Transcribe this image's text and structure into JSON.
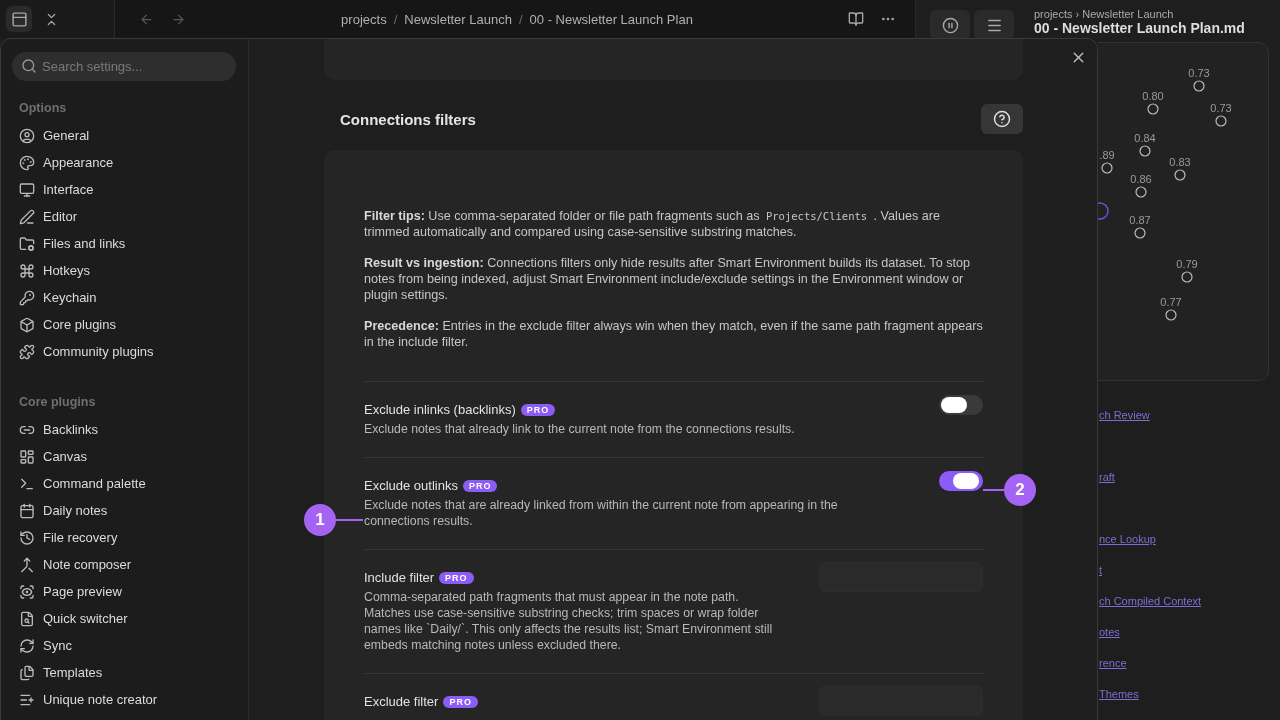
{
  "top_bar": {
    "breadcrumb": {
      "separator": "/",
      "parts": [
        "projects",
        "Newsletter Launch",
        "00 - Newsletter Launch Plan"
      ]
    }
  },
  "right_pane": {
    "path": "projects › Newsletter Launch",
    "title": "00 - Newsletter Launch Plan.md",
    "graph_nodes": [
      {
        "label": "0.73"
      },
      {
        "label": "0.80"
      },
      {
        "label": "0.73"
      },
      {
        "label": "0.84"
      },
      {
        "label": ".89"
      },
      {
        "label": "0.83"
      },
      {
        "label": "0.86"
      },
      {
        "label": "0.87"
      },
      {
        "label": "0.79"
      },
      {
        "label": "0.77"
      }
    ],
    "links": [
      "ch Review",
      "raft",
      "nce Lookup",
      "t",
      "ch Compiled Context",
      "otes",
      "rence",
      " Themes"
    ]
  },
  "settings": {
    "search": {
      "placeholder": "Search settings..."
    },
    "sections": [
      {
        "heading": "Options",
        "items": [
          {
            "label": "General"
          },
          {
            "label": "Appearance"
          },
          {
            "label": "Interface"
          },
          {
            "label": "Editor"
          },
          {
            "label": "Files and links"
          },
          {
            "label": "Hotkeys"
          },
          {
            "label": "Keychain"
          },
          {
            "label": "Core plugins"
          },
          {
            "label": "Community plugins"
          }
        ]
      },
      {
        "heading": "Core plugins",
        "items": [
          {
            "label": "Backlinks"
          },
          {
            "label": "Canvas"
          },
          {
            "label": "Command palette"
          },
          {
            "label": "Daily notes"
          },
          {
            "label": "File recovery"
          },
          {
            "label": "Note composer"
          },
          {
            "label": "Page preview"
          },
          {
            "label": "Quick switcher"
          },
          {
            "label": "Sync"
          },
          {
            "label": "Templates"
          },
          {
            "label": "Unique note creator"
          }
        ]
      }
    ],
    "panel": {
      "heading": "Connections filters",
      "tips": [
        [
          {
            "kind": "text",
            "text": "**Filter tips:** Use comma-separated folder or file path fragments such as "
          },
          {
            "kind": "code",
            "text": "Projects/Clients"
          },
          {
            "kind": "text",
            "text": " . Values are trimmed automatically and compared using case-sensitive substring matches."
          }
        ],
        [
          {
            "kind": "text",
            "text": "**Result vs ingestion:** Connections filters only hide results after Smart Environment builds its dataset. To stop notes from being indexed, adjust Smart Environment include/exclude settings in the Environment window or plugin settings."
          }
        ],
        [
          {
            "kind": "text",
            "text": "**Precedence:** Entries in the exclude filter always win when they match, even if the same path fragment appears in the include filter."
          }
        ]
      ],
      "rows": [
        {
          "kind": "toggle",
          "name": "Exclude inlinks (backlinks)",
          "badge": "PRO",
          "description": "Exclude notes that already link to the current note from the connections results.",
          "on": false
        },
        {
          "kind": "toggle",
          "name": "Exclude outlinks",
          "badge": "PRO",
          "description": "Exclude notes that are already linked from within the current note from appearing in the connections results.",
          "on": true
        },
        {
          "kind": "text",
          "name": "Include filter",
          "badge": "PRO",
          "description": "Comma-separated path fragments that must appear in the note path. Matches use case-sensitive substring checks; trim spaces or wrap folder names like `Daily/`. This only affects the results list; Smart Environment still embeds matching notes unless excluded there."
        },
        {
          "kind": "text",
          "name": "Exclude filter",
          "badge": "PRO"
        }
      ]
    }
  },
  "annotations": [
    {
      "label": "1"
    },
    {
      "label": "2"
    }
  ]
}
